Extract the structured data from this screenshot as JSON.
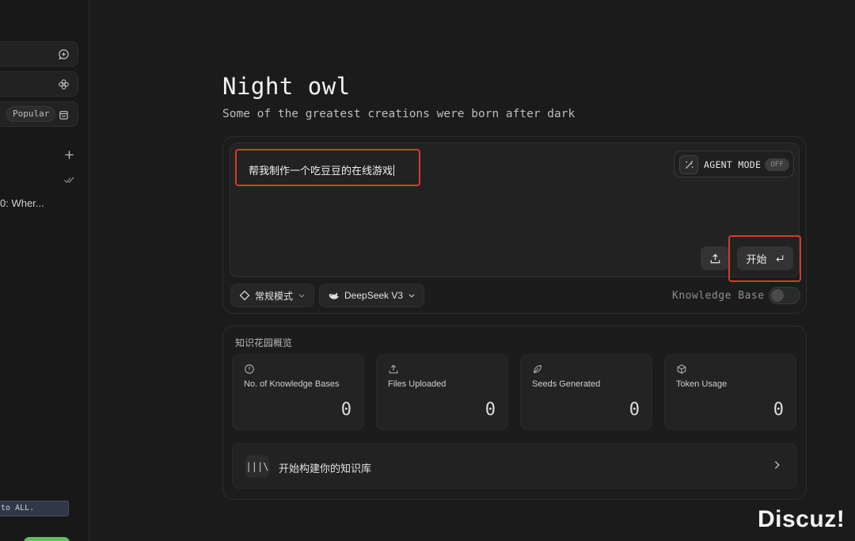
{
  "sidebar": {
    "popular_label": "Popular",
    "chat_item": "0: Wher...",
    "notice": "to ALL."
  },
  "hero": {
    "title": "Night owl",
    "subtitle": "Some of the greatest creations were born after dark"
  },
  "composer": {
    "prompt": "帮我制作一个吃豆豆的在线游戏",
    "agent_mode_label": "AGENT MODE",
    "agent_mode_state": "OFF",
    "start_label": "开始",
    "mode_label": "常规模式",
    "model_label": "DeepSeek V3",
    "knowledge_base_label": "Knowledge Base"
  },
  "garden": {
    "title": "知识花园概览",
    "stats": [
      {
        "label": "No. of Knowledge Bases",
        "value": "0",
        "icon": "info-icon"
      },
      {
        "label": "Files Uploaded",
        "value": "0",
        "icon": "upload-icon"
      },
      {
        "label": "Seeds Generated",
        "value": "0",
        "icon": "seed-icon"
      },
      {
        "label": "Token Usage",
        "value": "0",
        "icon": "cube-icon"
      }
    ],
    "build_label": "开始构建你的知识库"
  },
  "watermark": "Discuz!",
  "colors": {
    "background": "#1b1b1b",
    "highlight": "#d63a2a",
    "accent_green": "#5fc15f"
  }
}
